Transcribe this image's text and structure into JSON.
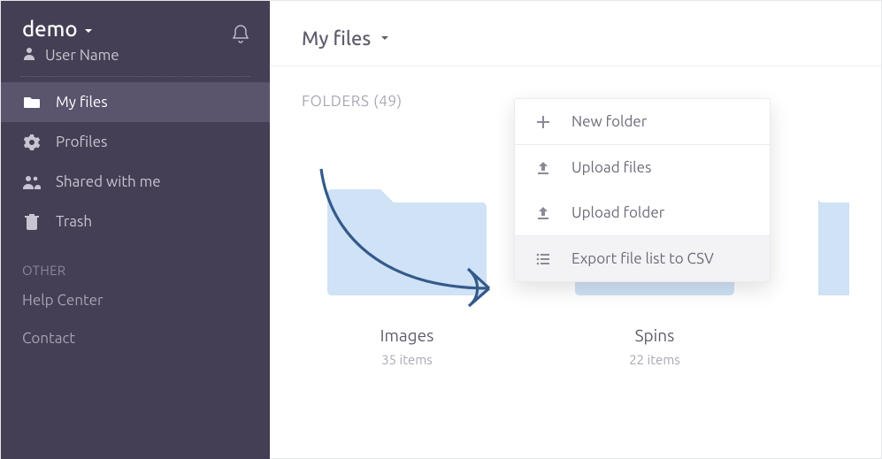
{
  "sidebar": {
    "brand": "demo",
    "user_label": "User Name",
    "nav": [
      {
        "label": "My files",
        "icon": "folder-icon",
        "active": true
      },
      {
        "label": "Profiles",
        "icon": "gear-icon",
        "active": false
      },
      {
        "label": "Shared with me",
        "icon": "people-icon",
        "active": false
      },
      {
        "label": "Trash",
        "icon": "trash-icon",
        "active": false
      }
    ],
    "other_section_label": "OTHER",
    "other_items": [
      {
        "label": "Help Center"
      },
      {
        "label": "Contact"
      }
    ]
  },
  "main": {
    "breadcrumb_title": "My files",
    "section_label": "FOLDERS (49)",
    "folders": [
      {
        "name": "Images",
        "items_text": "35 items",
        "items_count": 35
      },
      {
        "name": "Spins",
        "items_text": "22 items",
        "items_count": 22
      }
    ]
  },
  "context_menu": {
    "items": [
      {
        "label": "New folder",
        "icon": "plus-icon"
      },
      {
        "label": "Upload files",
        "icon": "upload-icon"
      },
      {
        "label": "Upload folder",
        "icon": "upload-icon"
      },
      {
        "label": "Export file list to CSV",
        "icon": "list-icon",
        "highlighted": true
      }
    ]
  }
}
